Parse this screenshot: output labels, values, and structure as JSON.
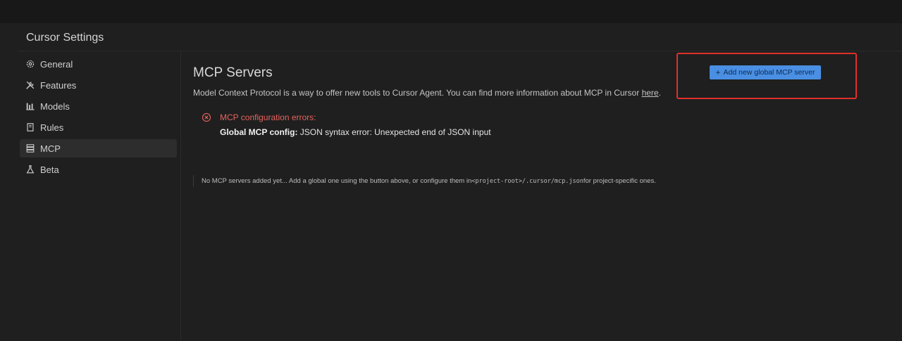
{
  "window": {
    "title": "Cursor Settings"
  },
  "sidebar": {
    "items": [
      {
        "label": "General",
        "icon": "gear-icon",
        "active": false
      },
      {
        "label": "Features",
        "icon": "tools-icon",
        "active": false
      },
      {
        "label": "Models",
        "icon": "bar-chart-icon",
        "active": false
      },
      {
        "label": "Rules",
        "icon": "book-icon",
        "active": false
      },
      {
        "label": "MCP",
        "icon": "server-icon",
        "active": true
      },
      {
        "label": "Beta",
        "icon": "flask-icon",
        "active": false
      }
    ]
  },
  "mcp": {
    "title": "MCP Servers",
    "description": "Model Context Protocol is a way to offer new tools to Cursor Agent. You can find more information about MCP in Cursor ",
    "description_link": "here",
    "description_end": ".",
    "add_button_icon": "+",
    "add_button_label": "Add new global MCP server",
    "error": {
      "title": "MCP configuration errors:",
      "detail_label": "Global MCP config:",
      "detail_text": " JSON syntax error: Unexpected end of JSON input"
    },
    "empty_note": {
      "prefix": "No MCP servers added yet... Add a global one using the button above, or configure them in ",
      "path": "<project-root>/.cursor/mcp.json",
      "suffix": " for project-specific ones."
    }
  },
  "colors": {
    "accent": "#4a8fe3",
    "error": "#e5635e",
    "highlight": "#e0302a",
    "background": "#1f1f1f"
  }
}
